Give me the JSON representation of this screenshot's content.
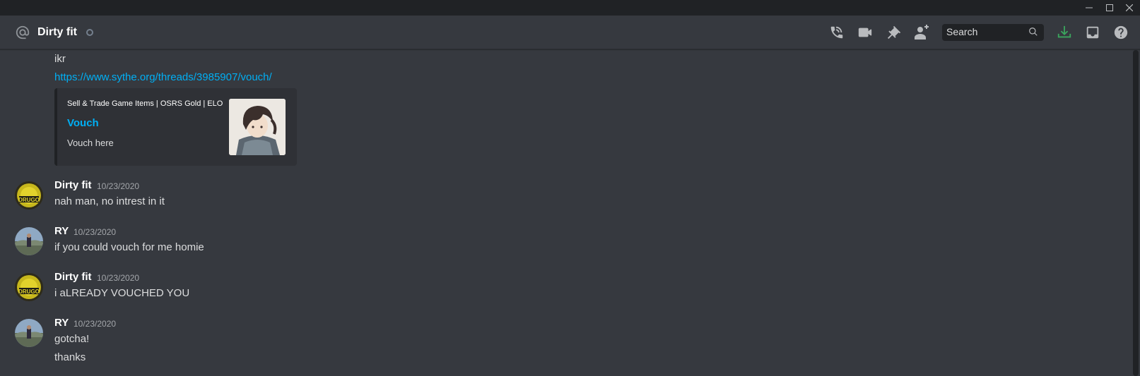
{
  "window": {
    "minimize_icon": "minimize-icon",
    "maximize_icon": "maximize-icon",
    "close_icon": "close-icon"
  },
  "header": {
    "channel_icon": "at-icon",
    "title": "Dirty fit",
    "status": "offline",
    "actions": [
      "start-voice-call-icon",
      "start-video-call-icon",
      "pinned-messages-icon",
      "add-friends-to-dm-icon"
    ],
    "search_placeholder": "Search",
    "right_icons": [
      "download-icon",
      "inbox-icon",
      "help-icon"
    ],
    "download_color": "#3ba55d"
  },
  "messages": {
    "continuation": {
      "text": "ikr",
      "link": "https://www.sythe.org/threads/3985907/vouch/",
      "embed": {
        "provider": "Sell & Trade Game Items | OSRS Gold | ELO",
        "title": "Vouch",
        "description": "Vouch here"
      }
    },
    "groups": [
      {
        "author": "Dirty fit",
        "timestamp": "10/23/2020",
        "lines": [
          "nah man, no intrest in it"
        ]
      },
      {
        "author": "RY",
        "timestamp": "10/23/2020",
        "lines": [
          "if you could vouch for me homie"
        ]
      },
      {
        "author": "Dirty fit",
        "timestamp": "10/23/2020",
        "lines": [
          "i aLREADY VOUCHED YOU"
        ]
      },
      {
        "author": "RY",
        "timestamp": "10/23/2020",
        "lines": [
          "gotcha!",
          "thanks"
        ]
      }
    ]
  },
  "colors": {
    "background": "#36393f",
    "titlebar": "#202225",
    "link": "#00aff4"
  }
}
